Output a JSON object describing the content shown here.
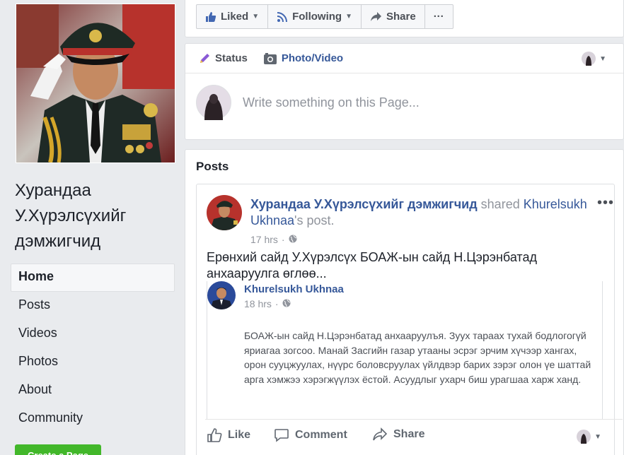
{
  "left": {
    "page_name": "Хурандаа У.Хүрэлсүхийг дэмжигчид",
    "nav": [
      {
        "label": "Home",
        "active": true
      },
      {
        "label": "Posts"
      },
      {
        "label": "Videos"
      },
      {
        "label": "Photos"
      },
      {
        "label": "About"
      },
      {
        "label": "Community"
      }
    ],
    "create_page_label": "Create a Page"
  },
  "actionbar": {
    "liked_label": "Liked",
    "following_label": "Following",
    "share_label": "Share",
    "more_label": "···"
  },
  "composer": {
    "status_label": "Status",
    "photo_label": "Photo/Video",
    "placeholder": "Write something on this Page..."
  },
  "posts": {
    "title": "Posts",
    "post": {
      "author": "Хурандаа У.Хүрэлсүхийг дэмжигчид",
      "shared_word": "shared",
      "original_author_link": "Khurelsukh Ukhnaa",
      "post_word": "'s post.",
      "time": "17 hrs",
      "menu": "•••",
      "text": "Ерөнхий сайд У.Хүрэлсүх БОАЖ-ын сайд Н.Цэрэнбатад анхааруулга өглөө...",
      "shared": {
        "author": "Khurelsukh Ukhnaa",
        "time": "18 hrs",
        "text": "БОАЖ-ын сайд Н.Цэрэнбатад анхааруулъя. Зуух тараах тухай бодлогогүй яриагаа зогсоо. Манай Засгийн газар утааны эсрэг эрчим хүчээр хангах, орон сууцжуулах, нүүрс боловсруулах үйлдвэр барих зэрэг олон үе шаттай арга хэмжээ хэрэгжүүлэх ёстой. Асуудлыг ухарч биш урагшаа харж ханд."
      },
      "actions": {
        "like": "Like",
        "comment": "Comment",
        "share": "Share"
      }
    }
  },
  "colors": {
    "link": "#365899",
    "muted": "#90949c",
    "background": "#e9ebee",
    "green": "#42b72a"
  }
}
